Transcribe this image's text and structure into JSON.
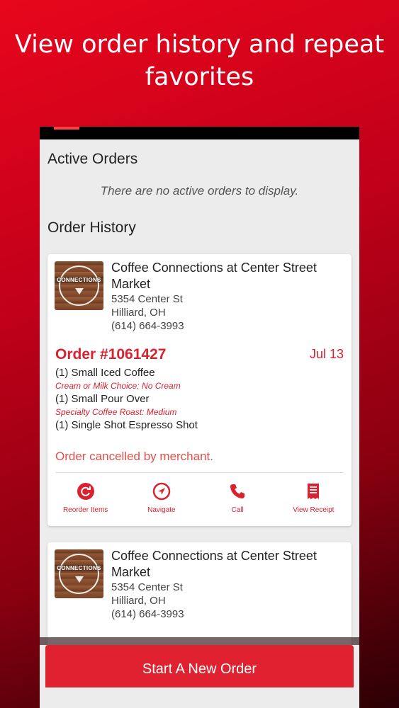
{
  "promo": {
    "title_line1": "View order history and repeat",
    "title_line2": "favorites"
  },
  "active_orders": {
    "title": "Active Orders",
    "empty_message": "There are no active orders to display."
  },
  "order_history": {
    "title": "Order History"
  },
  "orders": [
    {
      "merchant_name_line1": "Coffee Connections at Center Street",
      "merchant_name_line2": "Market",
      "address": "5354 Center St",
      "city": "Hilliard, OH",
      "phone": "(614) 664-3993",
      "logo_text": "CONNECTIONS",
      "order_number": "Order #1061427",
      "date": "Jul 13",
      "items": [
        {
          "name": "(1) Small Iced Coffee",
          "modifier": "Cream or Milk Choice: No Cream"
        },
        {
          "name": "(1) Small Pour Over",
          "modifier": "Specialty Coffee Roast: Medium"
        },
        {
          "name": "(1) Single Shot Espresso Shot",
          "modifier": ""
        }
      ],
      "status": "Order cancelled by merchant.",
      "actions": {
        "reorder": "Reorder Items",
        "navigate": "Navigate",
        "call": "Call",
        "receipt": "View Receipt"
      }
    },
    {
      "merchant_name_line1": "Coffee Connections at Center Street",
      "merchant_name_line2": "Market",
      "address": "5354 Center St",
      "city": "Hilliard, OH",
      "phone": "(614) 664-3993",
      "logo_text": "CONNECTIONS"
    }
  ],
  "bottom_button": {
    "label": "Start A New Order"
  },
  "colors": {
    "accent": "#d8222f",
    "background": "#e8061c"
  }
}
